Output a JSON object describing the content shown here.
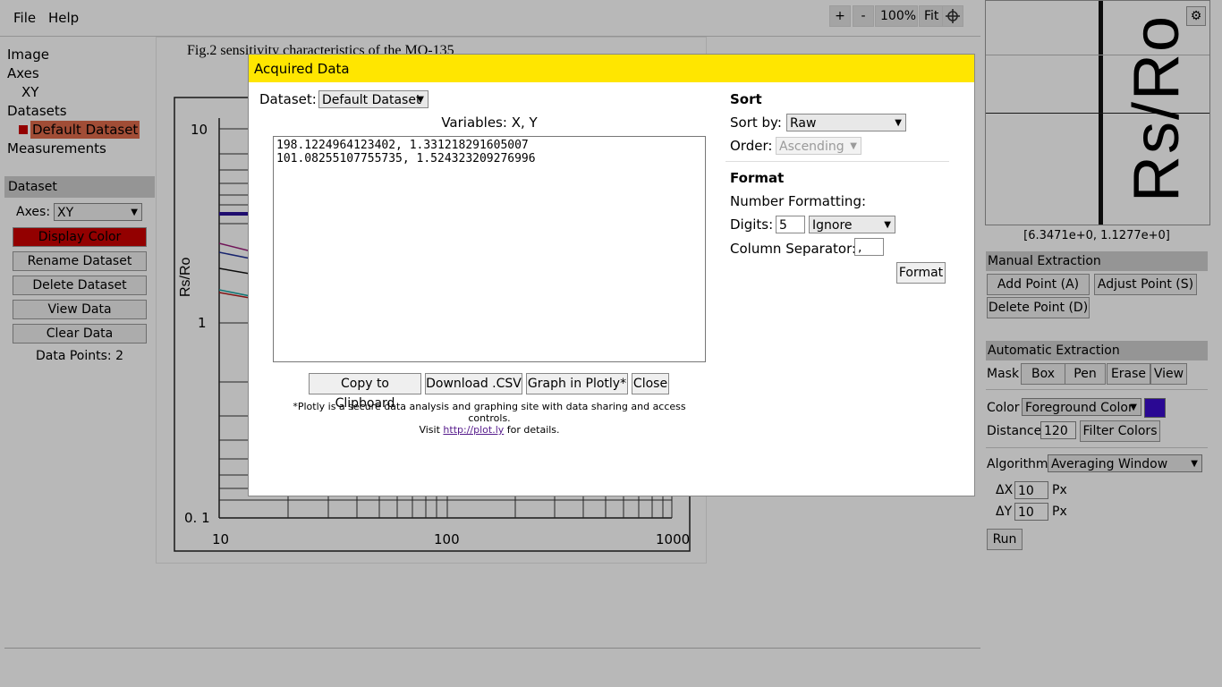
{
  "menubar": {
    "file": "File",
    "help": "Help",
    "zoom_in": "+",
    "zoom_out": "-",
    "zoom_level": "100%",
    "fit": "Fit"
  },
  "tree": {
    "image": "Image",
    "axes": "Axes",
    "axes_child": "XY",
    "datasets": "Datasets",
    "dataset_child": "Default Dataset",
    "measurements": "Measurements"
  },
  "dataset_panel": {
    "header": "Dataset",
    "axes_label": "Axes:",
    "axes_value": "XY",
    "display_color": "Display Color",
    "rename": "Rename Dataset",
    "delete": "Delete Dataset",
    "view": "View Data",
    "clear": "Clear Data",
    "points_label": "Data Points: 2",
    "display_color_hex": "#cc0000"
  },
  "canvas_image": {
    "caption": "Fig.2 sensitivity characteristics of the MQ-135",
    "ylabel": "Rs/Ro",
    "y_ticks": [
      "10",
      "1",
      "0. 1"
    ],
    "x_ticks": [
      "10",
      "100",
      "1000"
    ]
  },
  "magnifier": {
    "coords": "[6.3471e+0, 1.1277e+0]",
    "text": "Rs/Ro"
  },
  "manual": {
    "header": "Manual Extraction",
    "add": "Add Point (A)",
    "adjust": "Adjust Point (S)",
    "delete": "Delete Point (D)"
  },
  "auto": {
    "header": "Automatic Extraction",
    "mask_label": "Mask",
    "box": "Box",
    "pen": "Pen",
    "erase": "Erase",
    "view": "View",
    "color_label": "Color",
    "color_value": "Foreground Color",
    "swatch": "#3b0ccc",
    "distance_label": "Distance",
    "distance_value": "120",
    "filter": "Filter Colors",
    "algorithm_label": "Algorithm",
    "algorithm_value": "Averaging Window",
    "dx_label": "ΔX",
    "dx_value": "10",
    "dy_label": "ΔY",
    "dy_value": "10",
    "px": "Px",
    "run": "Run"
  },
  "dialog": {
    "title": "Acquired Data",
    "dataset_label": "Dataset:",
    "dataset_value": "Default Dataset",
    "variables": "Variables: X, Y",
    "data_text": "198.1224964123402, 1.331218291605007\n101.08255107755735, 1.524323209276996",
    "sort_header": "Sort",
    "sort_by_label": "Sort by:",
    "sort_by_value": "Raw",
    "order_label": "Order:",
    "order_value": "Ascending",
    "format_header": "Format",
    "number_formatting": "Number Formatting:",
    "digits_label": "Digits:",
    "digits_value": "5",
    "digits_mode": "Ignore",
    "col_sep_label": "Column Separator:",
    "col_sep_value": ",",
    "format_button": "Format",
    "copy": "Copy to Clipboard",
    "download": "Download .CSV",
    "plotly": "Graph in Plotly*",
    "close": "Close",
    "note": "*Plotly is a secure data analysis and graphing site with data sharing and access controls.",
    "visit_pre": "Visit",
    "visit_link": "http://plot.ly",
    "visit_post": "for details."
  }
}
